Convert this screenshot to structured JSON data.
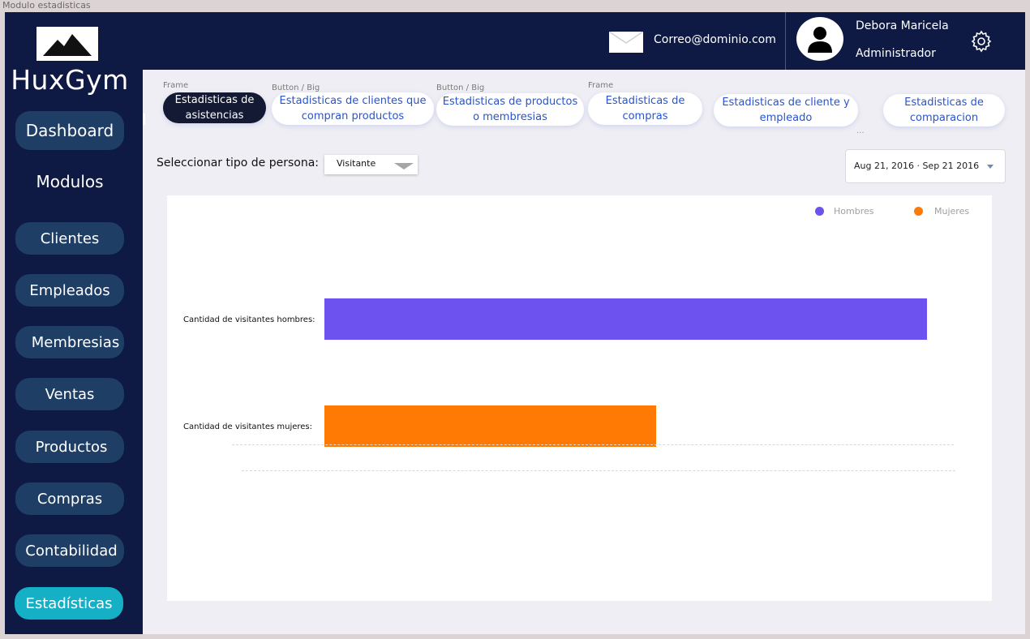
{
  "window_title": "Modulo estadisticas",
  "sidebar": {
    "brand": "HuxGym",
    "logo_icon": "mountain-logo-icon",
    "dashboard_label": "Dashboard",
    "section_label": "Modulos",
    "items": [
      {
        "label": "Clientes"
      },
      {
        "label": "Empleados"
      },
      {
        "label": "Membresias"
      },
      {
        "label": "Ventas"
      },
      {
        "label": "Productos"
      },
      {
        "label": "Compras"
      },
      {
        "label": "Contabilidad"
      },
      {
        "label": "Estadísticas",
        "active": true
      }
    ]
  },
  "header": {
    "email": "Correo@dominio.com",
    "user_name": "Debora Maricela",
    "user_role": "Administrador",
    "icons": [
      "mail-icon",
      "avatar-icon",
      "gear-icon"
    ]
  },
  "tabs": [
    {
      "tag": "Frame",
      "line1": "Estadisticas de",
      "line2": "asistencias",
      "active": true
    },
    {
      "tag": "Button / Big",
      "line1": "Estadisticas de clientes que",
      "line2": "compran productos"
    },
    {
      "tag": "Button / Big",
      "line1": "Estadisticas de productos",
      "line2": "o membresias"
    },
    {
      "tag": "Frame",
      "line1": "Estadisticas de",
      "line2": "compras"
    },
    {
      "tag": "",
      "line1": "Estadisticas de cliente y",
      "line2": "empleado"
    },
    {
      "tag": "",
      "line1": "Estadisticas de",
      "line2": "comparacion"
    }
  ],
  "tabs_overflow": "...",
  "filters": {
    "person_label": "Seleccionar tipo de persona:",
    "person_value": "Visitante",
    "date_range": "Aug 21, 2016 · Sep 21 2016"
  },
  "colors": {
    "sidebar_bg": "#0f1a44",
    "nav_btn": "#1f3e66",
    "nav_active": "#15b0c6",
    "hombres": "#6e52f0",
    "mujeres": "#ff7a05"
  },
  "chart_data": {
    "type": "bar",
    "orientation": "horizontal",
    "legend": [
      "Hombres",
      "Mujeres"
    ],
    "legend_position": "top-right",
    "categories": [
      "Cantidad de visitantes hombres:",
      "Cantidad de visitantes mujeres:"
    ],
    "values": [
      100,
      55
    ],
    "xlim": [
      0,
      100
    ],
    "grid": false
  }
}
